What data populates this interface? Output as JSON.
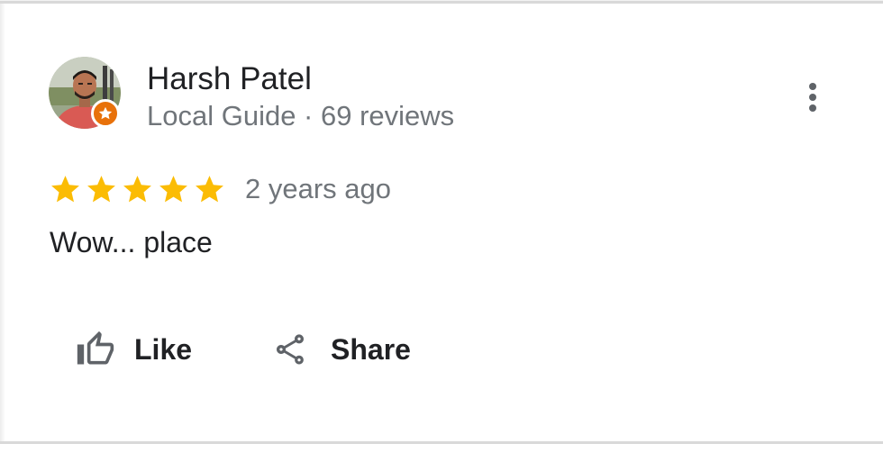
{
  "reviewer": {
    "name": "Harsh Patel",
    "meta": "Local Guide · 69 reviews",
    "badge_color": "#e8710a"
  },
  "review": {
    "rating": 5,
    "rating_max": 5,
    "star_color": "#fbbc04",
    "date": "2 years ago",
    "text": "Wow... place"
  },
  "actions": {
    "like_label": "Like",
    "share_label": "Share"
  },
  "icons": {
    "more": "more-vert-icon",
    "like": "thumb-up-outline-icon",
    "share": "share-icon",
    "badge": "local-guide-star-icon"
  }
}
